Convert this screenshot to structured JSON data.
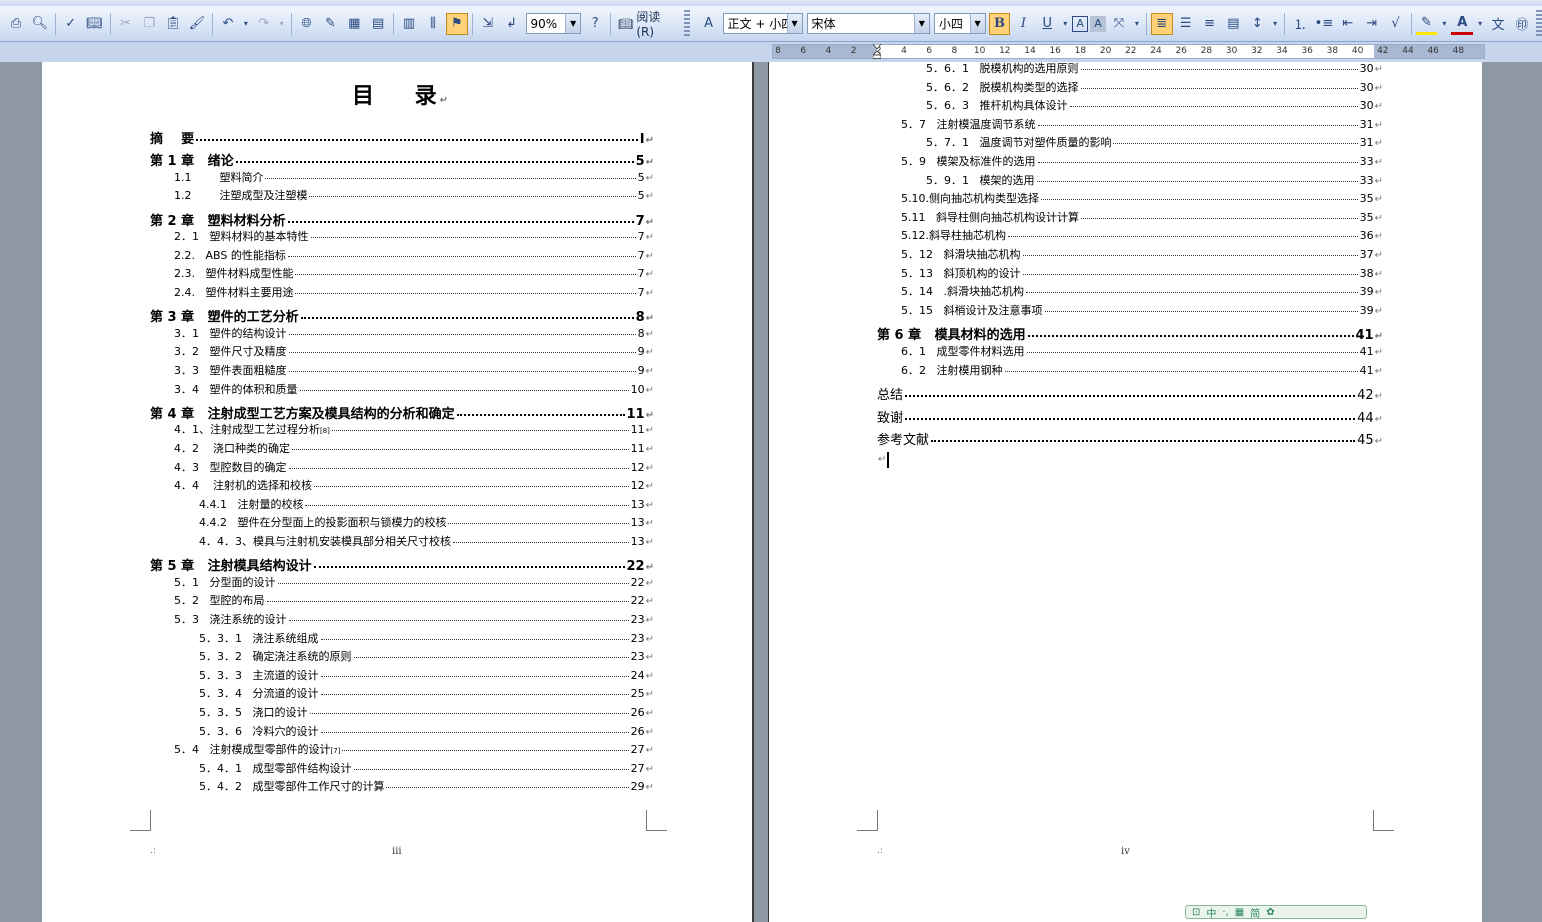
{
  "toolbar": {
    "zoom": "90%",
    "read_label": "阅读(R)",
    "style": "正文 + 小四",
    "font": "宋体",
    "size": "小四"
  },
  "ruler": {
    "ticks": [
      "8",
      "6",
      "4",
      "2",
      "2",
      "4",
      "6",
      "8",
      "10",
      "12",
      "14",
      "16",
      "18",
      "20",
      "22",
      "24",
      "26",
      "28",
      "30",
      "32",
      "34",
      "36",
      "38",
      "40",
      "42",
      "44",
      "46",
      "48"
    ]
  },
  "left_page": {
    "title": "目    录",
    "page_number": "iii",
    "entries": [
      {
        "level": 1,
        "label": "摘    要",
        "page": "I"
      },
      {
        "level": 1,
        "label": "第 1 章   绪论",
        "page": "5"
      },
      {
        "level": 2,
        "label": "1.1        塑料简介",
        "page": "5"
      },
      {
        "level": 2,
        "label": "1.2        注塑成型及注塑模",
        "page": "5"
      },
      {
        "level": 1,
        "label": "第 2 章   塑料材料分析",
        "page": "7"
      },
      {
        "level": 2,
        "label": "2．1   塑料材料的基本特性",
        "page": "7"
      },
      {
        "level": 2,
        "label": "2.2.   ABS 的性能指标",
        "page": "7"
      },
      {
        "level": 2,
        "label": "2.3.   塑件材料成型性能",
        "page": "7"
      },
      {
        "level": 2,
        "label": "2.4.   塑件材料主要用途",
        "page": "7"
      },
      {
        "level": 1,
        "label": "第 3 章   塑件的工艺分析",
        "page": "8"
      },
      {
        "level": 2,
        "label": "3．1   塑件的结构设计",
        "page": "8"
      },
      {
        "level": 2,
        "label": "3．2   塑件尺寸及精度",
        "page": "9"
      },
      {
        "level": 2,
        "label": "3．3   塑件表面粗糙度",
        "page": "9"
      },
      {
        "level": 2,
        "label": "3．4   塑件的体积和质量",
        "page": "10"
      },
      {
        "level": 1,
        "label": "第 4 章   注射成型工艺方案及模具结构的分析和确定",
        "page": "11"
      },
      {
        "level": 2,
        "label": "4．1、注射成型工艺过程分析",
        "sup": "[8]",
        "page": "11"
      },
      {
        "level": 2,
        "label": "4．2    浇口种类的确定",
        "page": "11"
      },
      {
        "level": 2,
        "label": "4．3   型腔数目的确定",
        "page": "12"
      },
      {
        "level": 2,
        "label": "4．4    注射机的选择和校核",
        "page": "12"
      },
      {
        "level": 3,
        "label": "4.4.1   注射量的校核",
        "page": "13"
      },
      {
        "level": 3,
        "label": "4.4.2   塑件在分型面上的投影面积与锁模力的校核",
        "page": "13"
      },
      {
        "level": 3,
        "label": "4．4．3、模具与注射机安装模具部分相关尺寸校核",
        "page": "13"
      },
      {
        "level": 1,
        "label": "第 5 章   注射模具结构设计",
        "page": "22"
      },
      {
        "level": 2,
        "label": "5．1   分型面的设计",
        "page": "22"
      },
      {
        "level": 2,
        "label": "5．2   型腔的布局",
        "page": "22"
      },
      {
        "level": 2,
        "label": "5．3   浇注系统的设计",
        "page": "23"
      },
      {
        "level": 3,
        "label": "5．3．1   浇注系统组成",
        "page": "23"
      },
      {
        "level": 3,
        "label": "5．3．2   确定浇注系统的原则",
        "page": "23"
      },
      {
        "level": 3,
        "label": "5．3．3   主流道的设计",
        "page": "24"
      },
      {
        "level": 3,
        "label": "5．3．4   分流道的设计",
        "page": "25"
      },
      {
        "level": 3,
        "label": "5．3．5   浇口的设计",
        "page": "26"
      },
      {
        "level": 3,
        "label": "5．3．6   冷料穴的设计",
        "page": "26"
      },
      {
        "level": 2,
        "label": "5．4   注射模成型零部件的设计",
        "sup": "[7]",
        "page": "27"
      },
      {
        "level": 3,
        "label": "5．4．1   成型零部件结构设计",
        "page": "27"
      },
      {
        "level": 3,
        "label": "5．4．2   成型零部件工作尺寸的计算",
        "page": "29"
      }
    ]
  },
  "right_page": {
    "page_number": "iv",
    "entries": [
      {
        "level": 3,
        "label": "5．6．1   脱模机构的选用原则",
        "page": "30"
      },
      {
        "level": 3,
        "label": "5．6．2   脱模机构类型的选择",
        "page": "30"
      },
      {
        "level": 3,
        "label": "5．6．3   推杆机构具体设计",
        "page": "30"
      },
      {
        "level": 2,
        "label": "5．7   注射模温度调节系统",
        "page": "31"
      },
      {
        "level": 3,
        "label": "5．7．1   温度调节对塑件质量的影响",
        "page": "31"
      },
      {
        "level": 2,
        "label": "5．9   模架及标准件的选用",
        "page": "33"
      },
      {
        "level": 3,
        "label": "5．9．1   模架的选用",
        "page": "33"
      },
      {
        "level": 2,
        "label": "5.10.侧向抽芯机构类型选择",
        "page": "35"
      },
      {
        "level": 2,
        "label": "5.11   斜导柱侧向抽芯机构设计计算",
        "page": "35"
      },
      {
        "level": 2,
        "label": "5.12.斜导柱抽芯机构",
        "page": "36"
      },
      {
        "level": 2,
        "label": "5．12   斜滑块抽芯机构",
        "page": "37"
      },
      {
        "level": 2,
        "label": "5．13   斜顶机构的设计",
        "page": "38"
      },
      {
        "level": 2,
        "label": "5．14   .斜滑块抽芯机构",
        "page": "39"
      },
      {
        "level": 2,
        "label": "5．15   斜梢设计及注意事项",
        "page": "39"
      },
      {
        "level": 1,
        "label": "第 6 章   模具材料的选用",
        "page": "41"
      },
      {
        "level": 2,
        "label": "6．1   成型零件材料选用",
        "page": "41"
      },
      {
        "level": 2,
        "label": "6．2   注射模用钢种",
        "page": "41"
      },
      {
        "level": 1,
        "label": "总结",
        "page": "42",
        "plain": true
      },
      {
        "level": 1,
        "label": "致谢",
        "page": "44",
        "plain": true
      },
      {
        "level": 1,
        "label": "参考文献",
        "page": "45",
        "plain": true
      }
    ]
  },
  "paragraph_mark": "↵"
}
